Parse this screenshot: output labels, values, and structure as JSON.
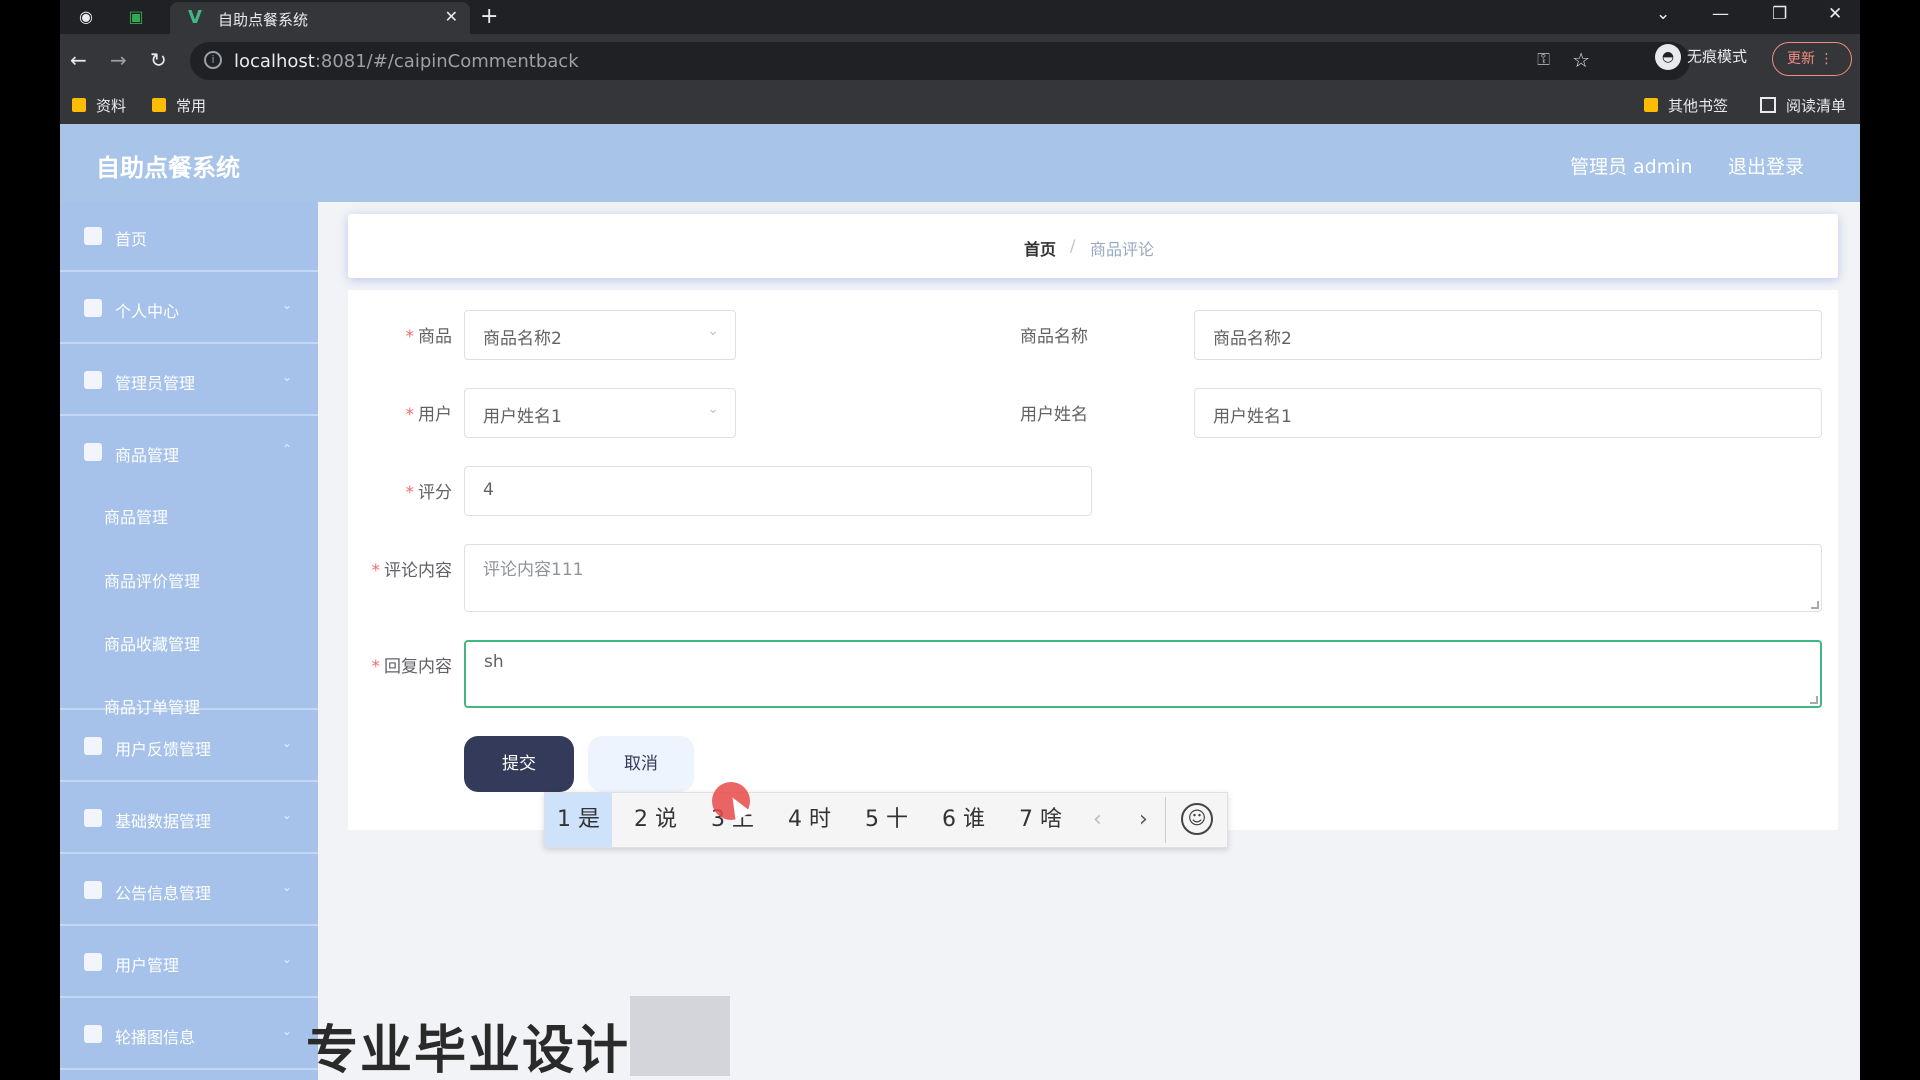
{
  "browser": {
    "tab_title": "自助点餐系统",
    "tab_close": "✕",
    "new_tab": "+",
    "url_host": "localhost",
    "url_rest": ":8081/#/caipinCommentback",
    "incognito_label": "无痕模式",
    "update_label": "更新",
    "bookmarks": [
      "资料",
      "常用"
    ],
    "other_bookmarks": "其他书签",
    "reading_list": "阅读清单"
  },
  "app": {
    "title": "自助点餐系统",
    "admin_label": "管理员 admin",
    "logout_label": "退出登录"
  },
  "sidebar": {
    "items": [
      {
        "label": "首页",
        "icon": "home-icon"
      },
      {
        "label": "个人中心",
        "icon": "user-icon"
      },
      {
        "label": "管理员管理",
        "icon": "admin-icon"
      },
      {
        "label": "商品管理",
        "icon": "goods-icon"
      },
      {
        "label": "用户反馈管理",
        "icon": "feedback-icon"
      },
      {
        "label": "基础数据管理",
        "icon": "data-icon"
      },
      {
        "label": "公告信息管理",
        "icon": "notice-icon"
      },
      {
        "label": "用户管理",
        "icon": "users-icon"
      },
      {
        "label": "轮播图信息",
        "icon": "carousel-icon"
      }
    ],
    "subitems": [
      "商品管理",
      "商品评价管理",
      "商品收藏管理",
      "商品订单管理"
    ]
  },
  "breadcrumb": {
    "home": "首页",
    "separator": "/",
    "current": "商品评论"
  },
  "form": {
    "goods_label": "商品",
    "goods_value": "商品名称2",
    "goods_name_label": "商品名称",
    "goods_name_value": "商品名称2",
    "user_label": "用户",
    "user_value": "用户姓名1",
    "user_name_label": "用户姓名",
    "user_name_value": "用户姓名1",
    "score_label": "评分",
    "score_value": "4",
    "comment_label": "评论内容",
    "comment_value": "评论内容111",
    "reply_label": "回复内容",
    "reply_value": "sh",
    "required_mark": "*",
    "submit_label": "提交",
    "cancel_label": "取消"
  },
  "ime": {
    "candidates": [
      "1 是",
      "2 说",
      "3 上",
      "4 时",
      "5 十",
      "6 谁",
      "7 啥"
    ],
    "prev": "‹",
    "next": "›"
  },
  "watermark": "专业毕业设计"
}
